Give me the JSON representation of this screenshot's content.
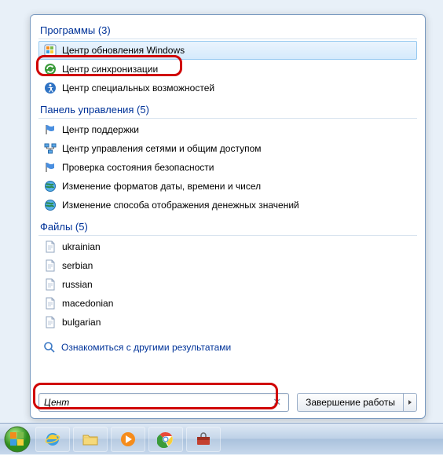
{
  "sections": {
    "programs": {
      "header": "Программы (3)",
      "items": [
        {
          "label": "Центр обновления Windows",
          "icon": "windows-update"
        },
        {
          "label": "Центр синхронизации",
          "icon": "sync"
        },
        {
          "label": "Центр специальных возможностей",
          "icon": "accessibility"
        }
      ]
    },
    "control_panel": {
      "header": "Панель управления (5)",
      "items": [
        {
          "label": "Центр поддержки",
          "icon": "flag"
        },
        {
          "label": "Центр управления сетями и общим доступом",
          "icon": "network"
        },
        {
          "label": "Проверка состояния безопасности",
          "icon": "flag"
        },
        {
          "label": "Изменение форматов даты, времени и чисел",
          "icon": "globe"
        },
        {
          "label": "Изменение способа отображения денежных значений",
          "icon": "globe"
        }
      ]
    },
    "files": {
      "header": "Файлы (5)",
      "items": [
        {
          "label": "ukrainian",
          "icon": "file"
        },
        {
          "label": "serbian",
          "icon": "file"
        },
        {
          "label": "russian",
          "icon": "file"
        },
        {
          "label": "macedonian",
          "icon": "file"
        },
        {
          "label": "bulgarian",
          "icon": "file"
        }
      ]
    }
  },
  "see_more": "Ознакомиться с другими результатами",
  "search": {
    "value": "Цент"
  },
  "shutdown": {
    "label": "Завершение работы"
  }
}
